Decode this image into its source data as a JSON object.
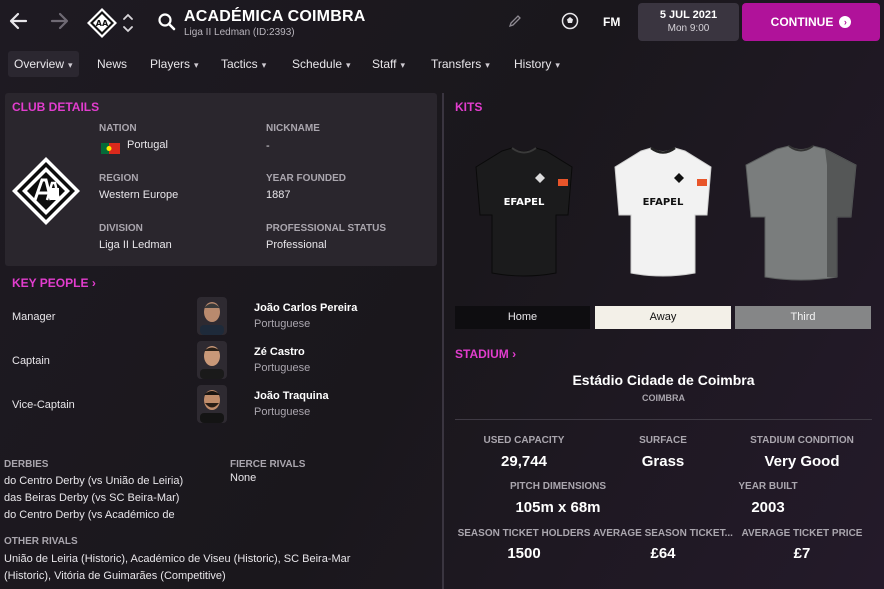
{
  "header": {
    "club_name": "ACADÉMICA COIMBRA",
    "club_subtitle": "Liga II Ledman (ID:2393)",
    "fm_label": "FM",
    "date": "5 JUL 2021",
    "day_time": "Mon 9:00",
    "continue_label": "CONTINUE"
  },
  "menu": {
    "items": [
      {
        "label": "Overview",
        "caret": "⌄"
      },
      {
        "label": "News",
        "caret": ""
      },
      {
        "label": "Players",
        "caret": "⌄"
      },
      {
        "label": "Tactics",
        "caret": "⌄"
      },
      {
        "label": "Schedule",
        "caret": "⌄"
      },
      {
        "label": "Staff",
        "caret": "⌄"
      },
      {
        "label": "Transfers",
        "caret": "⌄"
      },
      {
        "label": "History",
        "caret": "⌄"
      }
    ]
  },
  "club_details": {
    "title": "CLUB DETAILS",
    "nation_label": "NATION",
    "nation": "Portugal",
    "nickname_label": "NICKNAME",
    "nickname": "-",
    "region_label": "REGION",
    "region": "Western Europe",
    "year_founded_label": "YEAR FOUNDED",
    "year_founded": "1887",
    "division_label": "DIVISION",
    "division": "Liga II Ledman",
    "professional_status_label": "PROFESSIONAL STATUS",
    "professional_status": "Professional"
  },
  "key_people": {
    "title": "KEY PEOPLE",
    "people": [
      {
        "role": "Manager",
        "name": "João Carlos Pereira",
        "nationality": "Portuguese"
      },
      {
        "role": "Captain",
        "name": "Zé Castro",
        "nationality": "Portuguese"
      },
      {
        "role": "Vice-Captain",
        "name": "João Traquina",
        "nationality": "Portuguese"
      }
    ]
  },
  "rivals": {
    "derbies_label": "DERBIES",
    "derbies": [
      "do Centro Derby (vs União de Leiria)",
      "das Beiras Derby (vs SC Beira-Mar)",
      "do Centro Derby (vs Académico de"
    ],
    "fierce_label": "FIERCE RIVALS",
    "fierce": "None",
    "other_label": "OTHER RIVALS",
    "other_lines": [
      "União de Leiria (Historic), Académico de Viseu (Historic), SC Beira-Mar",
      "(Historic), Vitória de Guimarães (Competitive)"
    ]
  },
  "kits": {
    "title": "KITS",
    "sponsor": "EFAPEL",
    "tabs": [
      "Home",
      "Away",
      "Third"
    ],
    "selected_tab": "Away"
  },
  "stadium": {
    "title": "STADIUM",
    "name": "Estádio Cidade de Coimbra",
    "city": "COIMBRA",
    "used_capacity_label": "USED CAPACITY",
    "used_capacity": "29,744",
    "surface_label": "SURFACE",
    "surface": "Grass",
    "condition_label": "STADIUM CONDITION",
    "condition": "Very Good",
    "pitch_label": "PITCH DIMENSIONS",
    "pitch": "105m x 68m",
    "year_built_label": "YEAR BUILT",
    "year_built": "2003",
    "season_holders_label": "SEASON TICKET HOLDERS",
    "season_holders": "1500",
    "avg_season_label": "AVERAGE SEASON TICKET...",
    "avg_season": "£64",
    "avg_ticket_label": "AVERAGE TICKET PRICE",
    "avg_ticket": "£7"
  },
  "colors": {
    "accent": "#e23dce",
    "continue": "#b0129a",
    "panel": "#2a262d"
  }
}
